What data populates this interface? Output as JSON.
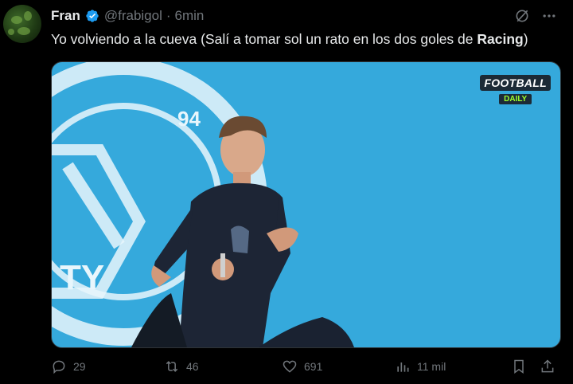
{
  "tweet": {
    "author_name": "Fran",
    "handle": "@frabigol",
    "separator": "·",
    "time": "6min",
    "text_main": "Yo volviendo a la cueva (Salí a tomar sol un rato en los dos goles de ",
    "text_bold": "Racing",
    "text_end": ")"
  },
  "media": {
    "watermark_main": "FOOTBALL",
    "watermark_sub": "DAILY",
    "background_color": "#35a9dc",
    "crest_text_1": "94",
    "crest_text_2": "TY"
  },
  "actions": {
    "replies": "29",
    "reposts": "46",
    "likes": "691",
    "views": "11 mil"
  },
  "colors": {
    "verified": "#1d9bf0",
    "muted": "#71767b",
    "text": "#e7e9ea"
  }
}
